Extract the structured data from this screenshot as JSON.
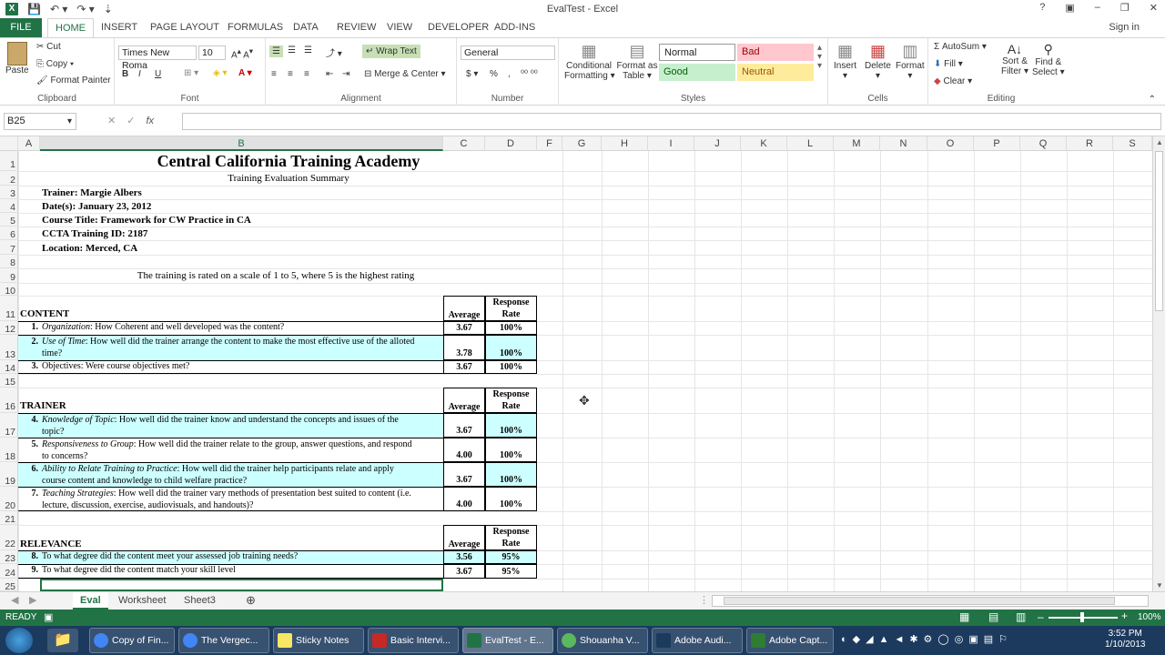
{
  "window": {
    "title": "EvalTest - Excel",
    "help": "?",
    "controls": [
      "▣",
      "–",
      "❐",
      "✕"
    ]
  },
  "ribbon_tabs": {
    "file": "FILE",
    "tabs": [
      "HOME",
      "INSERT",
      "PAGE LAYOUT",
      "FORMULAS",
      "DATA",
      "REVIEW",
      "VIEW",
      "DEVELOPER",
      "ADD-INS"
    ],
    "active": "HOME",
    "signin": "Sign in"
  },
  "clipboard": {
    "paste": "Paste",
    "cut": "Cut",
    "copy": "Copy",
    "format_painter": "Format Painter",
    "label": "Clipboard"
  },
  "font": {
    "name": "Times New Roma",
    "size": "10",
    "bold": "B",
    "italic": "I",
    "underline": "U",
    "label": "Font"
  },
  "alignment": {
    "wrap_text": "Wrap Text",
    "merge_center": "Merge & Center",
    "label": "Alignment"
  },
  "number": {
    "format": "General",
    "currency": "$",
    "percent": "%",
    "comma": ",",
    "label": "Number"
  },
  "styles": {
    "conditional": "Conditional",
    "formatting": "Formatting",
    "format_as": "Format as",
    "table": "Table",
    "normal": "Normal",
    "bad": "Bad",
    "good": "Good",
    "neutral": "Neutral",
    "label": "Styles"
  },
  "cells": {
    "insert": "Insert",
    "delete": "Delete",
    "format": "Format",
    "label": "Cells"
  },
  "editing": {
    "autosum": "AutoSum",
    "fill": "Fill",
    "clear": "Clear",
    "sort": "Sort &",
    "filter": "Filter",
    "find": "Find &",
    "select": "Select",
    "label": "Editing"
  },
  "formula_bar": {
    "cell_ref": "B25",
    "fx": "fx",
    "value": ""
  },
  "columns": [
    "A",
    "B",
    "C",
    "D",
    "F",
    "G",
    "H",
    "I",
    "J",
    "K",
    "L",
    "M",
    "N",
    "O",
    "P",
    "Q",
    "R",
    "S"
  ],
  "rows": [
    "1",
    "2",
    "3",
    "4",
    "5",
    "6",
    "7",
    "8",
    "9",
    "10",
    "11",
    "12",
    "13",
    "14",
    "15",
    "16",
    "17",
    "18",
    "19",
    "20",
    "21",
    "22",
    "23",
    "24",
    "25"
  ],
  "sheet": {
    "title": "Central California Training Academy",
    "subtitle": "Training Evaluation Summary",
    "trainer": "Trainer: Margie Albers",
    "dates": "Date(s): January 23, 2012",
    "course": "Course Title: Framework for CW Practice in CA",
    "ccta_id": "CCTA Training ID: 2187",
    "location": "Location: Merced, CA",
    "scale_note": "The training is rated on a scale of 1 to 5, where 5 is the highest rating",
    "col_average": "Average",
    "col_response": "Response",
    "col_rate": "Rate",
    "content_header": "CONTENT",
    "trainer_header": "TRAINER",
    "relevance_header": "RELEVANCE",
    "q1_num": "1.",
    "q1_lbl": "Organization",
    "q1_text": ": How Coherent and well developed was the content?",
    "q1_avg": "3.67",
    "q1_rate": "100%",
    "q2_num": "2.",
    "q2_lbl": "Use of Time",
    "q2_text": ": How well did the trainer arrange the content to make the most effective use of the alloted",
    "q2_text2": "time?",
    "q2_avg": "3.78",
    "q2_rate": "100%",
    "q3_num": "3.",
    "q3_text": "Objectives: Were course objectives met?",
    "q3_avg": "3.67",
    "q3_rate": "100%",
    "q4_num": "4.",
    "q4_lbl": "Knowledge of Topic",
    "q4_text": ": How well did the trainer know and understand the concepts and issues of the",
    "q4_text2": "topic?",
    "q4_avg": "3.67",
    "q4_rate": "100%",
    "q5_num": "5.",
    "q5_lbl": "Responsiveness to Group",
    "q5_text": ": How well did the trainer relate to the group, answer questions, and respond",
    "q5_text2": "to concerns?",
    "q5_avg": "4.00",
    "q5_rate": "100%",
    "q6_num": "6.",
    "q6_lbl": "Ability to Relate Training to Practice",
    "q6_text": ": How well did the trainer help participants relate and apply",
    "q6_text2": "course content and knowledge to child welfare practice?",
    "q6_avg": "3.67",
    "q6_rate": "100%",
    "q7_num": "7.",
    "q7_lbl": "Teaching Strategies",
    "q7_text": ": How well did the trainer vary methods of presentation best suited to content (i.e.",
    "q7_text2": "lecture, discussion, exercise, audiovisuals, and handouts)?",
    "q7_avg": "4.00",
    "q7_rate": "100%",
    "q8_num": "8.",
    "q8_text": "To what degree did the content meet your assessed job training needs?",
    "q8_avg": "3.56",
    "q8_rate": "95%",
    "q9_num": "9.",
    "q9_text": "To what degree did the content match your skill level",
    "q9_avg": "3.67",
    "q9_rate": "95%"
  },
  "sheet_tabs": [
    "Eval",
    "Worksheet",
    "Sheet3"
  ],
  "status": {
    "ready": "READY",
    "zoom": "100%"
  },
  "taskbar": {
    "items": [
      "Copy of Fin...",
      "The Vergec...",
      "Sticky Notes",
      "Basic Intervi...",
      "EvalTest - E...",
      "Shouanha V...",
      "Adobe Audi...",
      "Adobe Capt..."
    ],
    "time": "3:52 PM",
    "date": "1/10/2013"
  }
}
